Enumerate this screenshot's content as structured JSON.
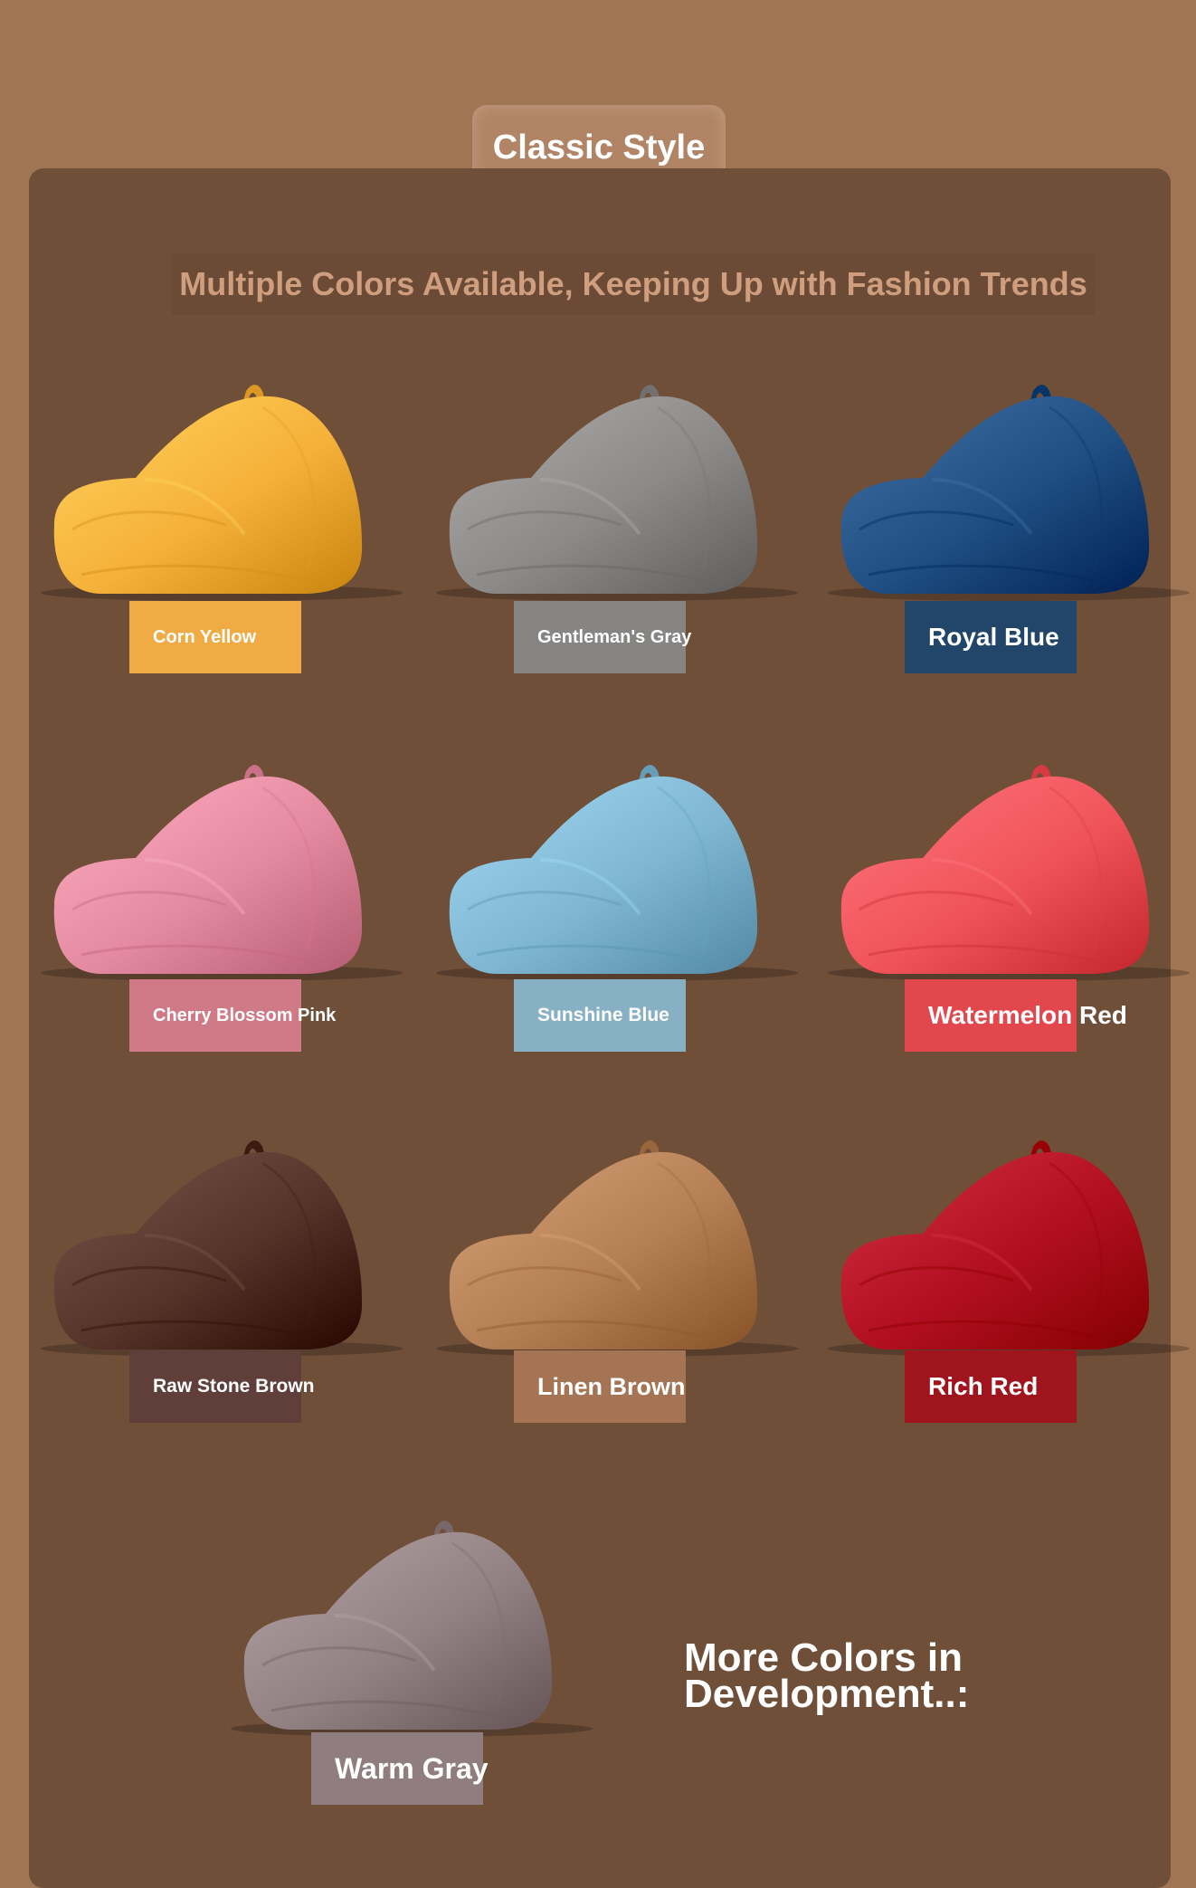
{
  "header": {
    "title": "Classic Style",
    "subtitle": "Multiple Colors Available, Keeping Up with Fashion Trends"
  },
  "colors": [
    {
      "label": "Corn Yellow",
      "fill": "#f5b13a",
      "tag": "#f0ab44"
    },
    {
      "label": "Gentleman's Gray",
      "fill": "#8c8a88",
      "tag": "#868583"
    },
    {
      "label": "Royal Blue",
      "fill": "#1f4e82",
      "tag": "#22456a"
    },
    {
      "label": "Cherry Blossom Pink",
      "fill": "#e48aa0",
      "tag": "#d17a87"
    },
    {
      "label": "Sunshine Blue",
      "fill": "#7fb7d2",
      "tag": "#87b0c4"
    },
    {
      "label": "Watermelon Red",
      "fill": "#f0535a",
      "tag": "#e2474d"
    },
    {
      "label": "Raw Stone Brown",
      "fill": "#553329",
      "tag": "#603f3a"
    },
    {
      "label": "Linen Brown",
      "fill": "#b47f54",
      "tag": "#a57455"
    },
    {
      "label": "Rich Red",
      "fill": "#b10f1f",
      "tag": "#a0141e"
    },
    {
      "label": "Warm Gray",
      "fill": "#928183",
      "tag": "#8f7d80"
    }
  ],
  "more": {
    "line1": "More Colors in",
    "line2": "Development..:"
  }
}
